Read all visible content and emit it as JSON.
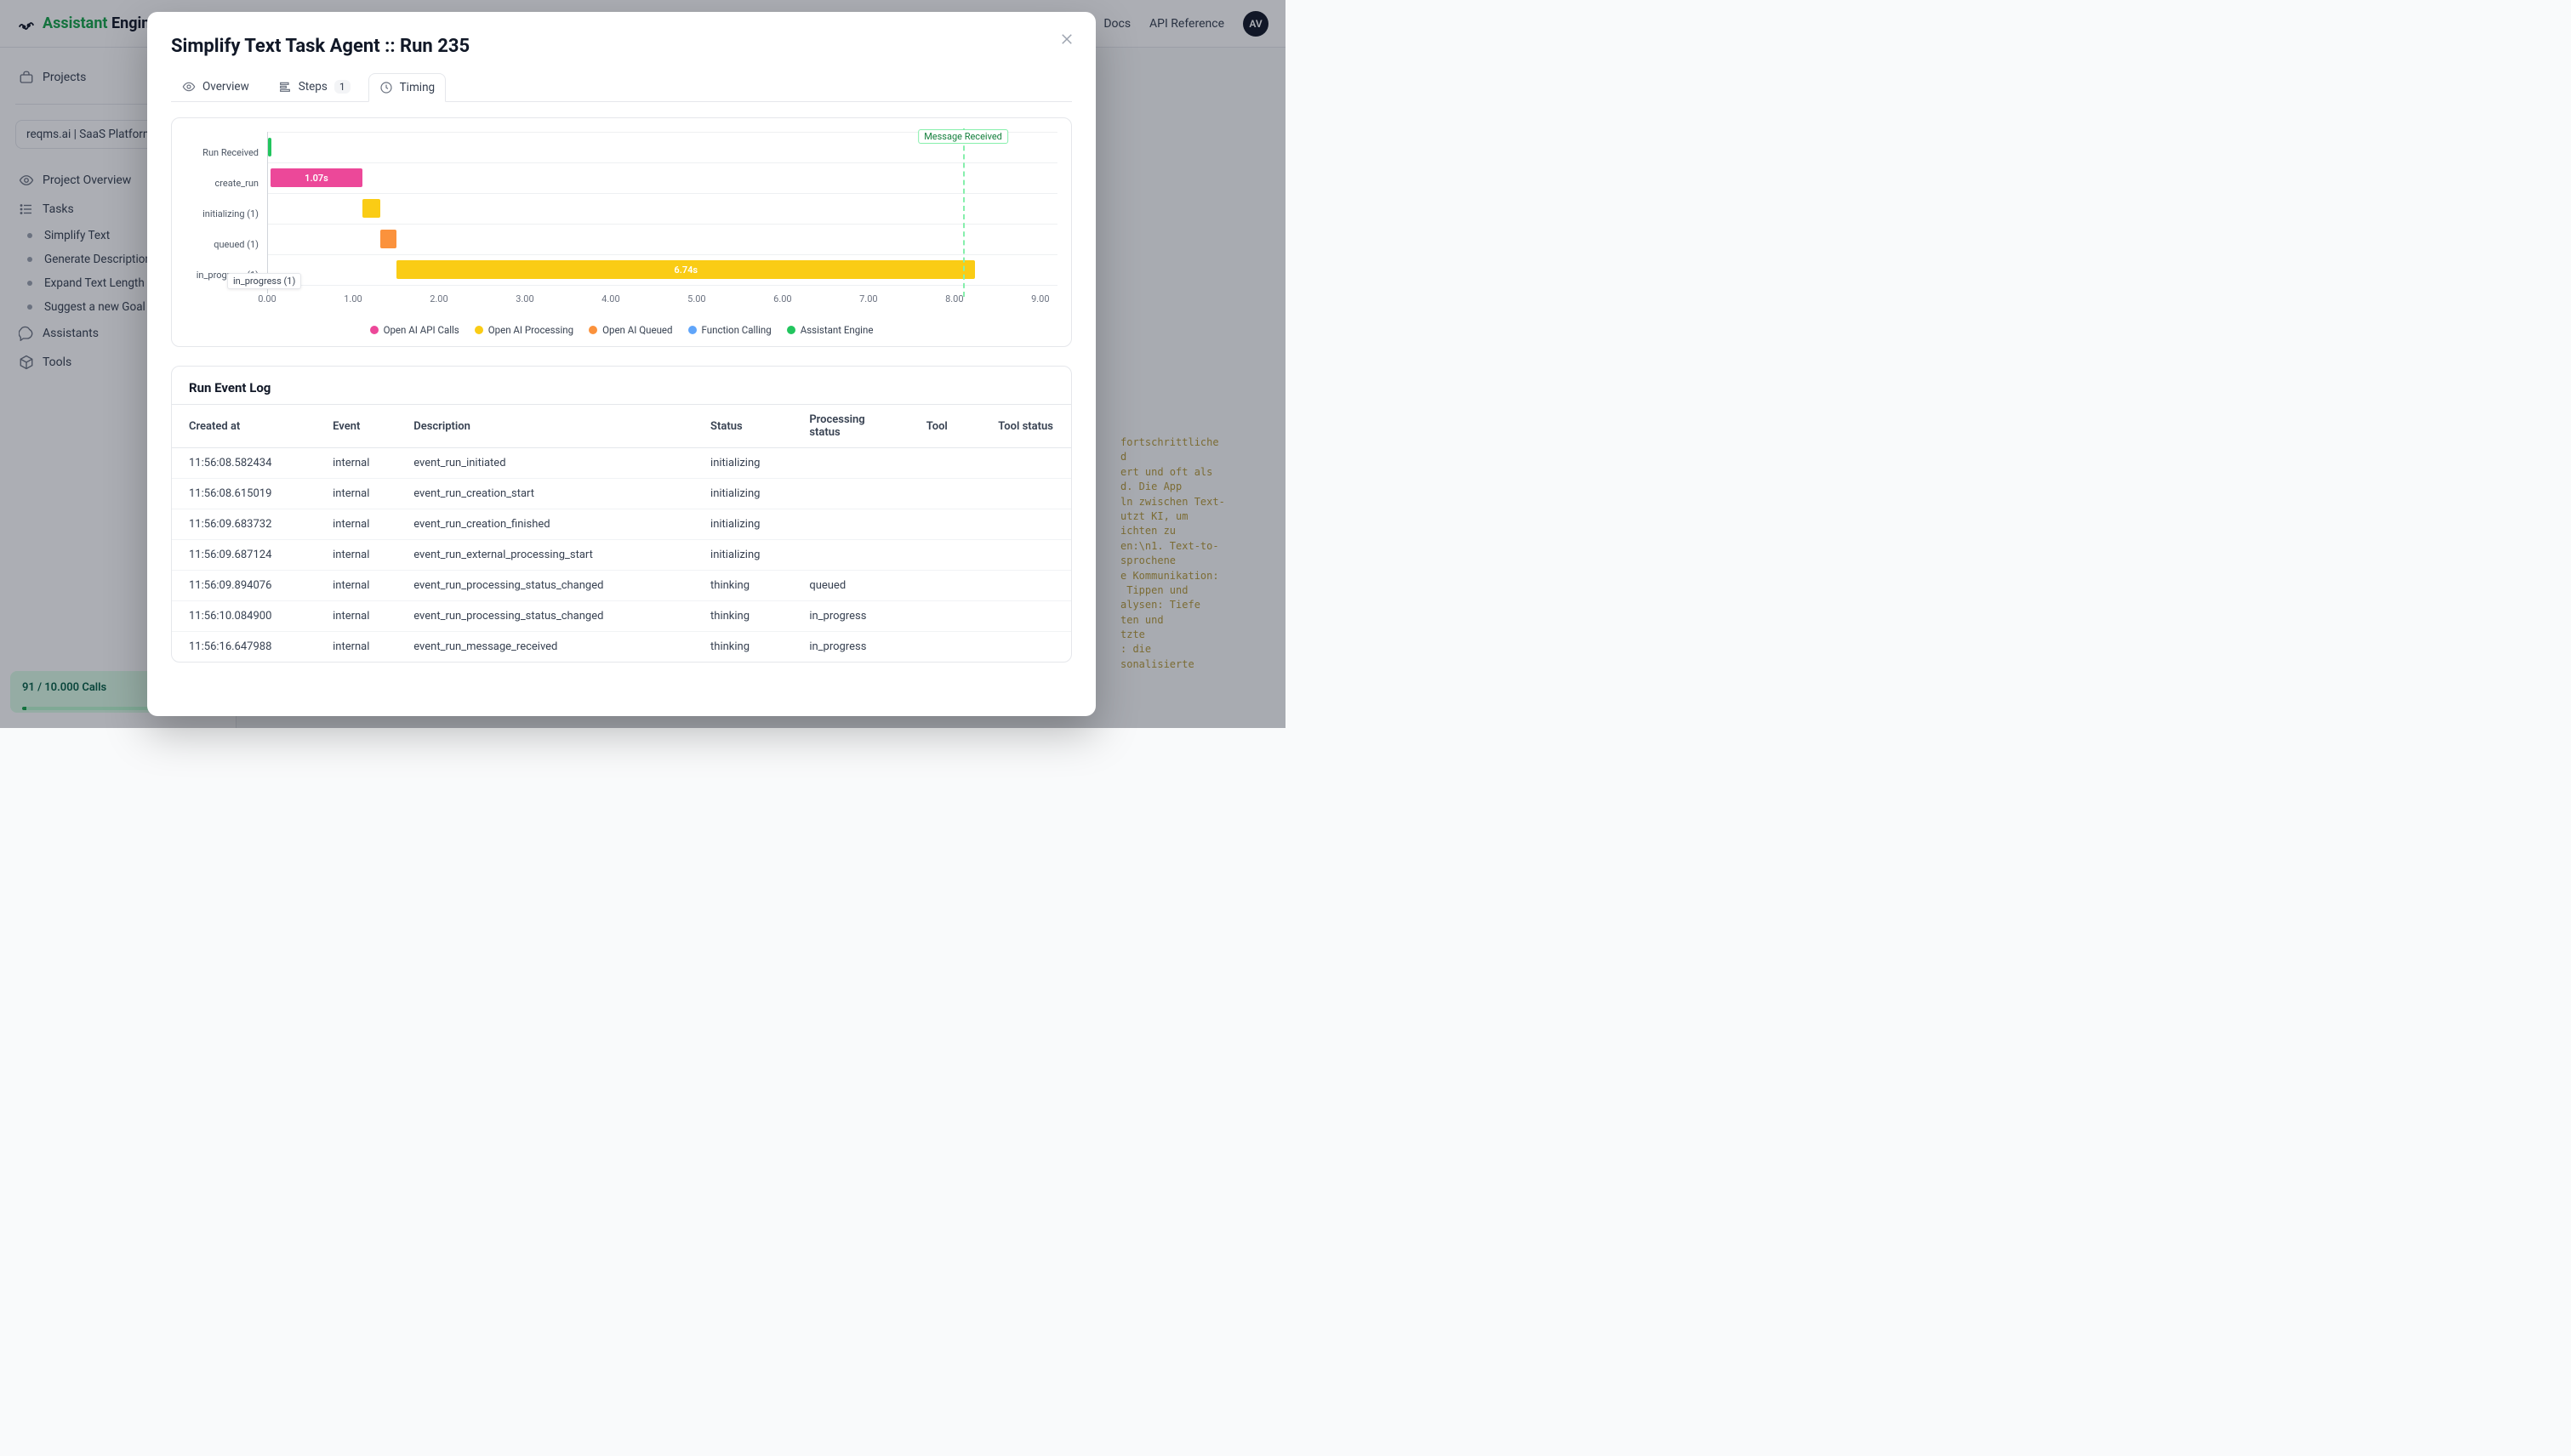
{
  "brand": {
    "a": "Assistant",
    "b": " Engine"
  },
  "topnav": {
    "docs": "Docs",
    "api": "API Reference",
    "avatar": "AV"
  },
  "sidebar": {
    "projects": "Projects",
    "project_chip": "reqms.ai | SaaS Platform",
    "overview": "Project Overview",
    "tasks": "Tasks",
    "task_items": [
      "Simplify Text",
      "Generate Descriptions",
      "Expand Text Length",
      "Suggest a new Goal"
    ],
    "assistants": "Assistants",
    "tools": "Tools",
    "usage": "91 / 10.000 Calls"
  },
  "modal": {
    "title": "Simplify Text Task Agent :: Run 235",
    "tabs": {
      "overview": "Overview",
      "steps": "Steps",
      "steps_count": "1",
      "timing": "Timing"
    }
  },
  "chart_data": {
    "type": "bar",
    "orientation": "horizontal",
    "xlabel": "",
    "ylabel": "",
    "xlim": [
      0,
      9.2
    ],
    "xticks": [
      0.0,
      1.0,
      2.0,
      3.0,
      4.0,
      5.0,
      6.0,
      7.0,
      8.0,
      9.0
    ],
    "xtick_labels": [
      "0.00",
      "1.00",
      "2.00",
      "3.00",
      "4.00",
      "5.00",
      "6.00",
      "7.00",
      "8.00",
      "9.00"
    ],
    "categories": [
      "Run Received",
      "create_run",
      "initializing (1)",
      "queued (1)",
      "in_progress (1)"
    ],
    "bars": [
      {
        "category": "Run Received",
        "start": 0.0,
        "end": 0.03,
        "series": "Assistant Engine",
        "label": ""
      },
      {
        "category": "create_run",
        "start": 0.03,
        "end": 1.1,
        "series": "Open AI API Calls",
        "label": "1.07s"
      },
      {
        "category": "initializing (1)",
        "start": 1.1,
        "end": 1.31,
        "series": "Open AI Processing",
        "label": ""
      },
      {
        "category": "queued (1)",
        "start": 1.31,
        "end": 1.5,
        "series": "Open AI Queued",
        "label": ""
      },
      {
        "category": "in_progress (1)",
        "start": 1.5,
        "end": 8.24,
        "series": "Open AI Processing",
        "label": "6.74s"
      }
    ],
    "series_colors": {
      "Open AI API Calls": "#ec4899",
      "Open AI Processing": "#facc15",
      "Open AI Queued": "#fb923c",
      "Function Calling": "#60a5fa",
      "Assistant Engine": "#22c55e"
    },
    "legend": [
      "Open AI API Calls",
      "Open AI Processing",
      "Open AI Queued",
      "Function Calling",
      "Assistant Engine"
    ],
    "marker": {
      "x": 8.1,
      "label": "Message Received"
    },
    "tooltip": {
      "category": "in_progress (1)",
      "text": "in_progress (1)"
    }
  },
  "log": {
    "title": "Run Event Log",
    "columns": [
      "Created at",
      "Event",
      "Description",
      "Status",
      "Processing status",
      "Tool",
      "Tool status"
    ],
    "rows": [
      {
        "created_at": "11:56:08.582434",
        "event": "internal",
        "description": "event_run_initiated",
        "status": "initializing",
        "processing_status": "",
        "tool": "",
        "tool_status": ""
      },
      {
        "created_at": "11:56:08.615019",
        "event": "internal",
        "description": "event_run_creation_start",
        "status": "initializing",
        "processing_status": "",
        "tool": "",
        "tool_status": ""
      },
      {
        "created_at": "11:56:09.683732",
        "event": "internal",
        "description": "event_run_creation_finished",
        "status": "initializing",
        "processing_status": "",
        "tool": "",
        "tool_status": ""
      },
      {
        "created_at": "11:56:09.687124",
        "event": "internal",
        "description": "event_run_external_processing_start",
        "status": "initializing",
        "processing_status": "",
        "tool": "",
        "tool_status": ""
      },
      {
        "created_at": "11:56:09.894076",
        "event": "internal",
        "description": "event_run_processing_status_changed",
        "status": "thinking",
        "processing_status": "queued",
        "tool": "",
        "tool_status": ""
      },
      {
        "created_at": "11:56:10.084900",
        "event": "internal",
        "description": "event_run_processing_status_changed",
        "status": "thinking",
        "processing_status": "in_progress",
        "tool": "",
        "tool_status": ""
      },
      {
        "created_at": "11:56:16.647988",
        "event": "internal",
        "description": "event_run_message_received",
        "status": "thinking",
        "processing_status": "in_progress",
        "tool": "",
        "tool_status": ""
      }
    ]
  },
  "ghost_text": "fortschrittliche\nd\nert und oft als\nd. Die App\nln zwischen Text-\nutzt KI, um\nichten zu\nen:\\n1. Text-to-\nsprochene\ne Kommunikation:\n Tippen und\nalysen: Tiefe\nten und\ntzte\n: die\nsonalisierte"
}
